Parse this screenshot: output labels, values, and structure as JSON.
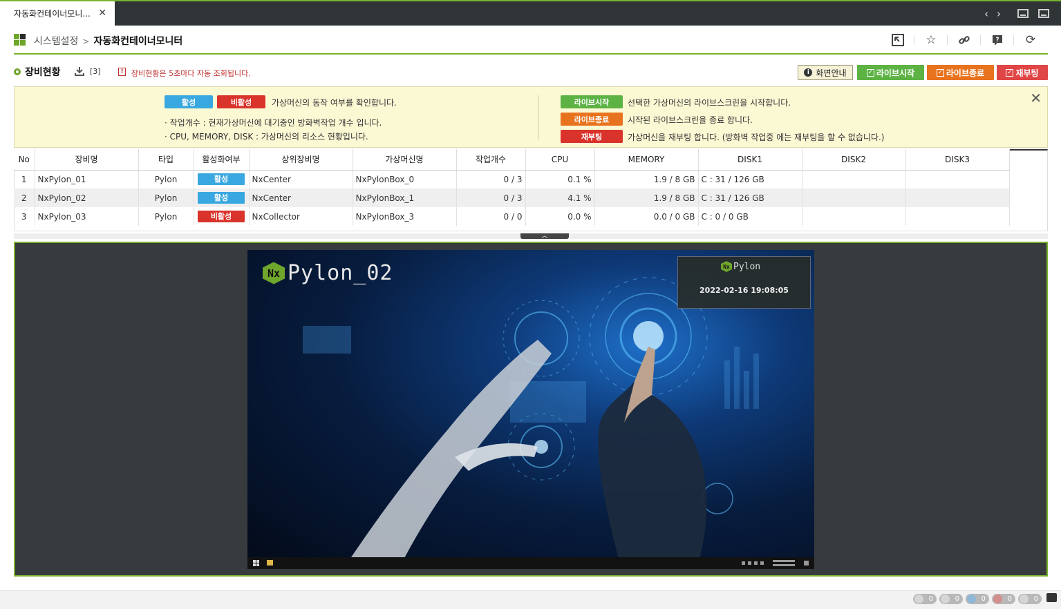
{
  "tab": {
    "title": "자동화컨테이너모니..."
  },
  "breadcrumb": {
    "parent": "시스템설정",
    "separator": ">",
    "current": "자동화컨테이너모니터"
  },
  "section": {
    "title": "장비현황",
    "count": "[3]",
    "refresh_notice": "장비현황은 5초마다 자동 조회됩니다."
  },
  "actions": {
    "guide": "화면안내",
    "live_start": "라이브시작",
    "live_stop": "라이브종료",
    "reboot": "재부팅"
  },
  "info": {
    "active": "활성",
    "inactive": "비활성",
    "status_desc": "가상머신의 동작 여부를 확인합니다.",
    "jobs_desc": "· 작업개수 : 현재가상머신에 대기중인 방화벽작업 개수 입니다.",
    "resource_desc": "· CPU, MEMORY, DISK : 가상머신의 리소스 현황입니다.",
    "live_start": "라이브시작",
    "live_start_desc": "선택한 가상머신의 라이브스크린을 시작합니다.",
    "live_stop": "라이브종료",
    "live_stop_desc": "시작된 라이브스크린을 종료 합니다.",
    "reboot": "재부팅",
    "reboot_desc": "가상머신을 재부팅 합니다. (방화벽 작업중 에는 재부팅을 할 수 없습니다.)"
  },
  "table": {
    "headers": [
      "No",
      "장비명",
      "타입",
      "활성화여부",
      "상위장비명",
      "가상머신명",
      "작업개수",
      "CPU",
      "MEMORY",
      "DISK1",
      "DISK2",
      "DISK3"
    ],
    "rows": [
      {
        "no": "1",
        "name": "NxPylon_01",
        "type": "Pylon",
        "status": "활성",
        "parent": "NxCenter",
        "vm": "NxPylonBox_0",
        "jobs": "0 / 3",
        "cpu": "0.1 %",
        "memory": "1.9 / 8 GB",
        "disk1": "C : 31 / 126 GB",
        "disk2": "",
        "disk3": ""
      },
      {
        "no": "2",
        "name": "NxPylon_02",
        "type": "Pylon",
        "status": "활성",
        "parent": "NxCenter",
        "vm": "NxPylonBox_1",
        "jobs": "0 / 3",
        "cpu": "4.1 %",
        "memory": "1.9 / 8 GB",
        "disk1": "C : 31 / 126 GB",
        "disk2": "",
        "disk3": ""
      },
      {
        "no": "3",
        "name": "NxPylon_03",
        "type": "Pylon",
        "status": "비활성",
        "parent": "NxCollector",
        "vm": "NxPylonBox_3",
        "jobs": "0 / 0",
        "cpu": "0.0 %",
        "memory": "0.0 / 0 GB",
        "disk1": "C : 0 / 0 GB",
        "disk2": "",
        "disk3": ""
      }
    ]
  },
  "live": {
    "logo": "Nx",
    "title": "Pylon_02",
    "clock_brand": "Pylon",
    "clock": "2022-02-16  19:08:05"
  },
  "status_counts": [
    "0",
    "0",
    "0",
    "0",
    "0"
  ],
  "colors": {
    "accent": "#7ab32e",
    "active": "#3aa8e0",
    "inactive": "#d9332b",
    "live_start": "#5cb344",
    "live_stop": "#e8731e",
    "reboot": "#e04646"
  }
}
